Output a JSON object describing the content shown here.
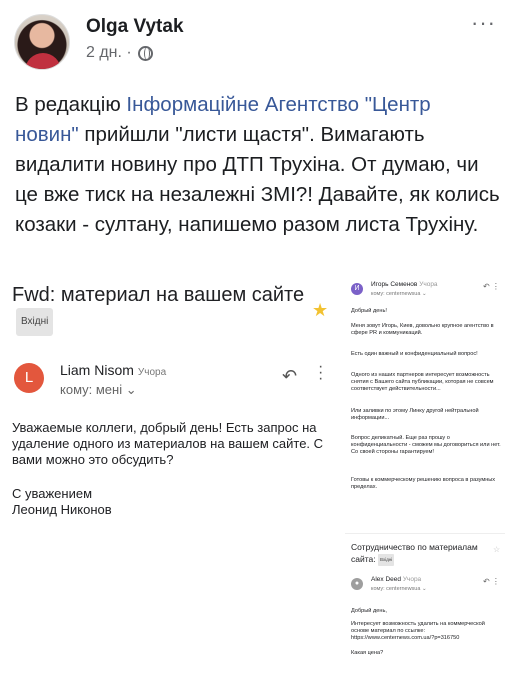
{
  "post": {
    "author": "Olga Vytak",
    "time": "2 дн. ·",
    "text_before_link": "В редакцію ",
    "link_text": "Інформаційне Агентство \"Центр новин\"",
    "text_after_link": " прийшли \"листи щастя\". Вимагають видалити новину про ДТП Трухіна. От думаю, чи це вже тиск на незалежні ЗМІ?! Давайте, як колись козаки - султану, напишемо разом листа Трухіну."
  },
  "email": {
    "subject": "Fwd: материал на вашем сайте",
    "label": "Вхідні",
    "sender_initial": "L",
    "sender_name": "Liam Nisom",
    "sender_time": "Учора",
    "sender_to": "кому: мені ⌄",
    "body": "Уважаемые коллеги, добрый день! Есть запрос на удаление одного из материалов на вашем сайте. С вами можно это обсудить?",
    "sign_line1": "С уважением",
    "sign_line2": "Леонид Никонов"
  },
  "side_email_1": {
    "initial": "И",
    "sender": "Игорь Семенов",
    "time": "Учора",
    "to": "кому: centernewsua ⌄",
    "p1": "Добрый день!",
    "p2": "Меня зовут Игорь, Киев, довольно крупное агентство в сфере PR и коммуникаций.",
    "p3": "Есть один важный и конфиденциальный вопрос!",
    "p4": "Одного из наших партнеров интересует возможность снятия с Вашего сайта публикации, которая не совсем соответствует действительности...",
    "p5": "Или заливки по этому Линку другой нейтральной информации...",
    "p6": "Вопрос деликатный. Еще раз прошу о конфиденциальности - сможем мы договориться или нет. Со своей стороны гарантируем!",
    "p7": "Готовы к коммерческому решению вопроса в разумных пределах."
  },
  "side_email_2": {
    "subject": "Сотрудничество по материалам сайта:",
    "label": "Вхідні",
    "sender": "Alex Deed",
    "time": "Учора",
    "to": "кому: centernewsua ⌄",
    "p1": "Добрый день,",
    "p2": "Интересует возможность удалить на коммерческой основе материал по ссылке: https://www.centernews.com.ua/?p=316750",
    "p3": "Какая цена?"
  },
  "icons": {
    "more": "more-horizontal-icon",
    "globe": "globe-icon",
    "star": "star-icon",
    "reply": "reply-icon",
    "kebab": "more-vertical-icon"
  },
  "colors": {
    "link": "#385898",
    "star": "#f2c231",
    "sender_avatar": "#e3573d"
  }
}
